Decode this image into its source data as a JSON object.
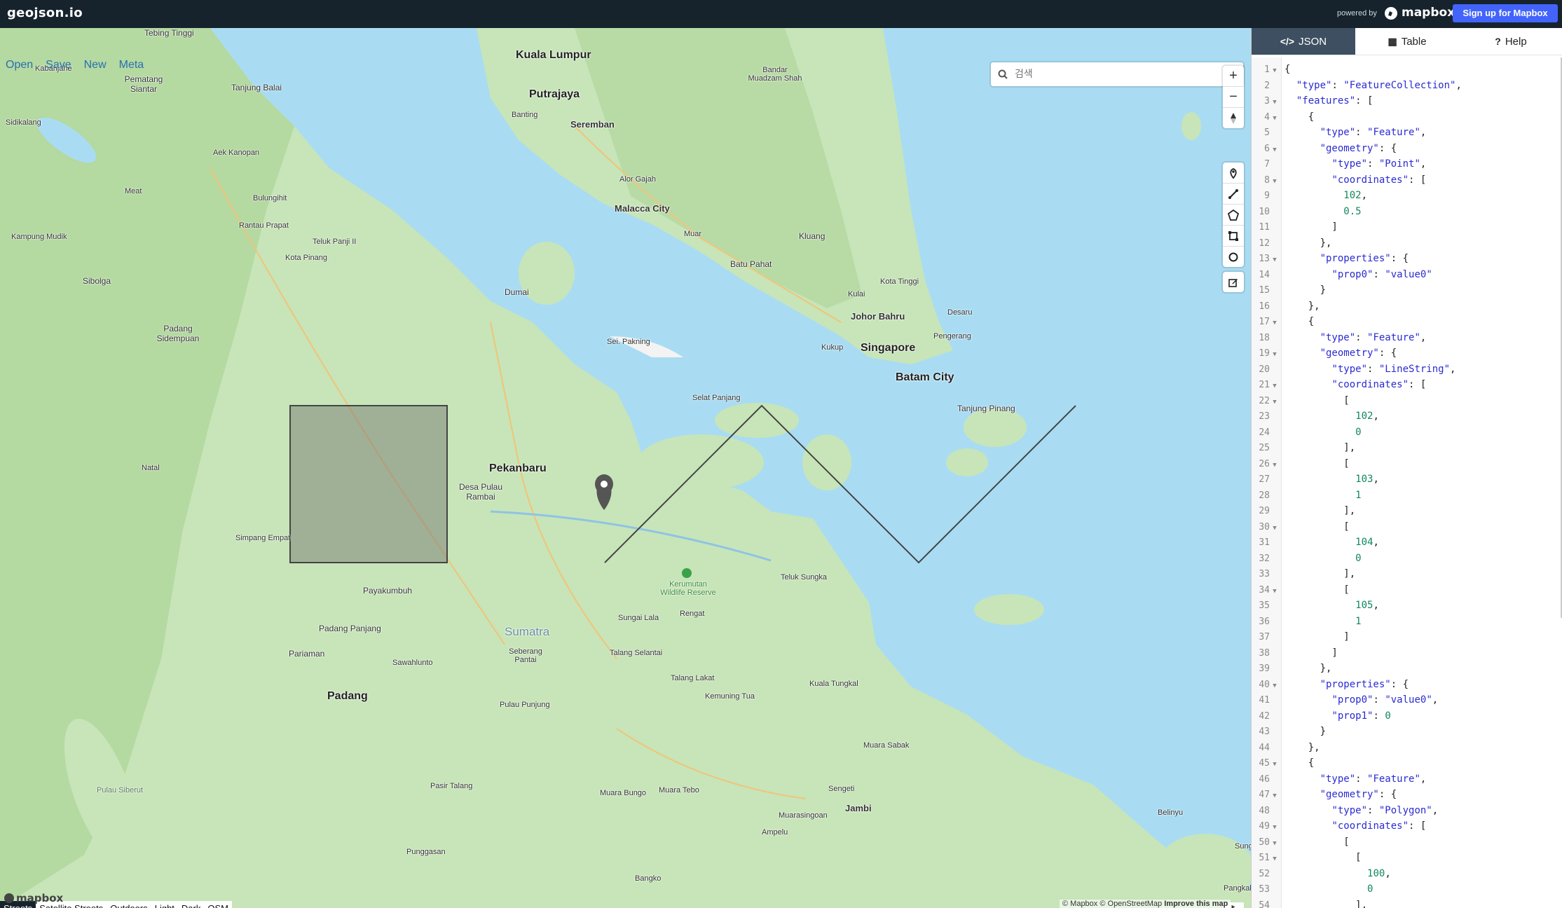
{
  "app": {
    "title": "geojson.io"
  },
  "topbar": {
    "powered_by": "powered by",
    "mapbox_word": "mapbox",
    "signup_label": "Sign up for Mapbox"
  },
  "menu": {
    "items": [
      "Open",
      "Save",
      "New",
      "Meta"
    ]
  },
  "search": {
    "placeholder": "검색"
  },
  "controls": {
    "zoom_in": "+",
    "zoom_out": "−"
  },
  "map_styles": {
    "items": [
      "Streets",
      "Satellite Streets",
      "Outdoors",
      "Light",
      "Dark",
      "OSM"
    ],
    "active": "Streets"
  },
  "attribution": {
    "text": "© Mapbox © OpenStreetMap",
    "improve": "Improve this map"
  },
  "map_logo": "mapbox",
  "map_labels": [
    {
      "text": "Kuala Lumpur",
      "big": true
    },
    {
      "text": "Putrajaya",
      "big": true
    },
    {
      "text": "Seremban",
      "big": true
    },
    {
      "text": "Malacca City",
      "big": true
    },
    {
      "text": "Johor Bahru",
      "big": true
    },
    {
      "text": "Singapore",
      "big": true
    },
    {
      "text": "Batam City",
      "big": true
    },
    {
      "text": "Pekanbaru",
      "big": true
    },
    {
      "text": "Padang",
      "big": true
    },
    {
      "text": "Jambi",
      "big": true
    },
    {
      "text": "Sumatra",
      "region": true
    },
    {
      "text": "Tebing Tinggi"
    },
    {
      "text": "Kabanjahe"
    },
    {
      "text": "Pematang Siantar"
    },
    {
      "text": "Tanjung Balai"
    },
    {
      "text": "Sidikalang"
    },
    {
      "text": "Aek Kanopan"
    },
    {
      "text": "Meat"
    },
    {
      "text": "Bulungihit"
    },
    {
      "text": "Kampung Mudik"
    },
    {
      "text": "Rantau Prapat"
    },
    {
      "text": "Teluk Panji II"
    },
    {
      "text": "Kota Pinang"
    },
    {
      "text": "Sibolga"
    },
    {
      "text": "Padang Sidempuan"
    },
    {
      "text": "Natal"
    },
    {
      "text": "Simpang Empat"
    },
    {
      "text": "Payakumbuh"
    },
    {
      "text": "Padang Panjang"
    },
    {
      "text": "Pariaman"
    },
    {
      "text": "Sawahlunto"
    },
    {
      "text": "Pulau Punjung"
    },
    {
      "text": "Pulau Siberut"
    },
    {
      "text": "Pasir Talang"
    },
    {
      "text": "Punggasan"
    },
    {
      "text": "Muara Bungo"
    },
    {
      "text": "Muara Tebo"
    },
    {
      "text": "Bangko"
    },
    {
      "text": "Muarasingoan"
    },
    {
      "text": "Ampelu"
    },
    {
      "text": "Sengeti"
    },
    {
      "text": "Muara Sabak"
    },
    {
      "text": "Kuala Tungkal"
    },
    {
      "text": "Kemuning Tua"
    },
    {
      "text": "Talang Lakat"
    },
    {
      "text": "Talang Selantai"
    },
    {
      "text": "Seberang Pantai"
    },
    {
      "text": "Sungai Lala"
    },
    {
      "text": "Rengat"
    },
    {
      "text": "Kerumutan Wildlife Reserve"
    },
    {
      "text": "Teluk Sungka"
    },
    {
      "text": "Desa Pulau Rambai"
    },
    {
      "text": "Dumai"
    },
    {
      "text": "Sei. Pakning"
    },
    {
      "text": "Selat Panjang"
    },
    {
      "text": "Tanjung Pinang"
    },
    {
      "text": "Kukup"
    },
    {
      "text": "Pengerang"
    },
    {
      "text": "Desaru"
    },
    {
      "text": "Kulai"
    },
    {
      "text": "Kota Tinggi"
    },
    {
      "text": "Kluang"
    },
    {
      "text": "Batu Pahat"
    },
    {
      "text": "Muar"
    },
    {
      "text": "Alor Gajah"
    },
    {
      "text": "Banting"
    },
    {
      "text": "Bandar Muadzam Shah"
    },
    {
      "text": "Belinyu"
    },
    {
      "text": "Sungsang"
    },
    {
      "text": "Pangkal"
    }
  ],
  "panel": {
    "tabs": [
      {
        "label": "JSON",
        "icon": "</>",
        "active": true
      },
      {
        "label": "Table",
        "icon": "▦",
        "active": false
      },
      {
        "label": "Help",
        "icon": "?",
        "active": false
      }
    ]
  },
  "code_lines": [
    "{",
    "  \"type\": \"FeatureCollection\",",
    "  \"features\": [",
    "    {",
    "      \"type\": \"Feature\",",
    "      \"geometry\": {",
    "        \"type\": \"Point\",",
    "        \"coordinates\": [",
    "          102,",
    "          0.5",
    "        ]",
    "      },",
    "      \"properties\": {",
    "        \"prop0\": \"value0\"",
    "      }",
    "    },",
    "    {",
    "      \"type\": \"Feature\",",
    "      \"geometry\": {",
    "        \"type\": \"LineString\",",
    "        \"coordinates\": [",
    "          [",
    "            102,",
    "            0",
    "          ],",
    "          [",
    "            103,",
    "            1",
    "          ],",
    "          [",
    "            104,",
    "            0",
    "          ],",
    "          [",
    "            105,",
    "            1",
    "          ]",
    "        ]",
    "      },",
    "      \"properties\": {",
    "        \"prop0\": \"value0\",",
    "        \"prop1\": 0",
    "      }",
    "    },",
    "    {",
    "      \"type\": \"Feature\",",
    "      \"geometry\": {",
    "        \"type\": \"Polygon\",",
    "        \"coordinates\": [",
    "          [",
    "            [",
    "              100,",
    "              0",
    "            ],"
  ],
  "fold_lines": [
    1,
    3,
    4,
    6,
    8,
    13,
    17,
    19,
    21,
    22,
    26,
    30,
    34,
    40,
    45,
    47,
    49,
    50,
    51
  ]
}
